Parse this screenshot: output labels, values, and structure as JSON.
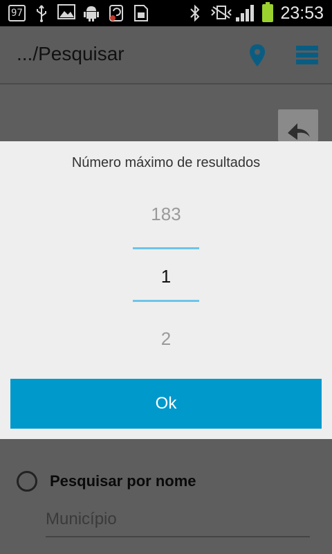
{
  "status_bar": {
    "icons": [
      "notification-count",
      "usb-icon",
      "image-icon",
      "android-icon",
      "sync-icon",
      "sim-icon"
    ],
    "notification_count": "97",
    "time": "23:53",
    "right_icons": [
      "bluetooth-icon",
      "vibrate-icon",
      "signal-icon",
      "battery-charging-icon"
    ]
  },
  "action_bar": {
    "title": ".../Pesquisar",
    "accent": "#0a5d82"
  },
  "dialog": {
    "title": "Número máximo de resultados",
    "picker": {
      "previous": "183",
      "current": "1",
      "next": "2"
    },
    "ok_label": "Ok",
    "accent": "#0099cc",
    "divider_color": "#6cc4ea"
  },
  "form": {
    "radio_label": "Pesquisar por nome",
    "municipio_placeholder": "Município"
  }
}
